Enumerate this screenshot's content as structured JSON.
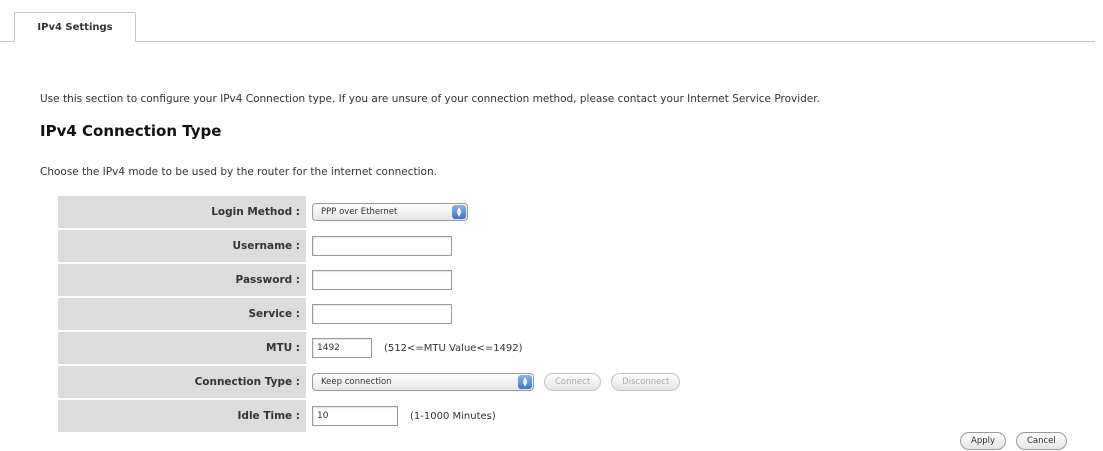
{
  "tabs": [
    {
      "label": "IPv4 Settings",
      "active": true
    }
  ],
  "intro_text": "Use this section to configure your IPv4 Connection type. If you are unsure of your connection method, please contact your Internet Service Provider.",
  "section": {
    "title": "IPv4 Connection Type",
    "description": "Choose the IPv4 mode to be used by the router for the internet connection."
  },
  "form": {
    "login_method": {
      "label": "Login Method :",
      "value": "PPP over Ethernet"
    },
    "username": {
      "label": "Username :",
      "value": ""
    },
    "password": {
      "label": "Password :",
      "value": ""
    },
    "service": {
      "label": "Service :",
      "value": ""
    },
    "mtu": {
      "label": "MTU :",
      "value": "1492",
      "hint": "(512<=MTU Value<=1492)"
    },
    "connection_type": {
      "label": "Connection Type :",
      "value": "Keep connection",
      "connect_label": "Connect",
      "disconnect_label": "Disconnect"
    },
    "idle_time": {
      "label": "Idle Time :",
      "value": "10",
      "hint": "(1-1000 Minutes)"
    }
  },
  "actions": {
    "apply_label": "Apply",
    "cancel_label": "Cancel"
  },
  "colors": {
    "label_background": "#dcdcdc",
    "select_arrow": "#3e74cf"
  }
}
